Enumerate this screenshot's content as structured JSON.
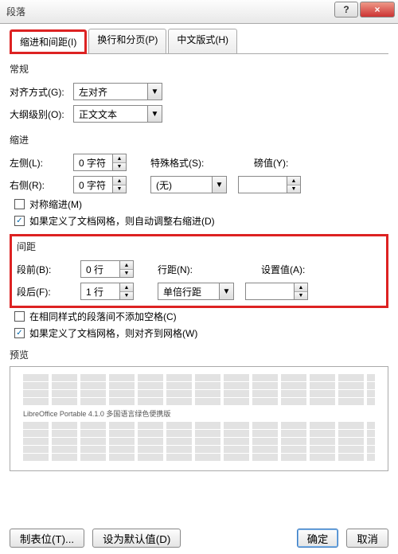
{
  "window": {
    "title": "段落",
    "help_icon": "?",
    "close_icon": "×"
  },
  "tabs": {
    "t1": "缩进和间距(I)",
    "t2": "换行和分页(P)",
    "t3": "中文版式(H)"
  },
  "general": {
    "title": "常规",
    "align_label": "对齐方式(G):",
    "align_value": "左对齐",
    "outline_label": "大纲级别(O):",
    "outline_value": "正文文本"
  },
  "indent": {
    "title": "缩进",
    "left_label": "左侧(L):",
    "left_value": "0 字符",
    "right_label": "右侧(R):",
    "right_value": "0 字符",
    "special_label": "特殊格式(S):",
    "special_value": "(无)",
    "by_label": "磅值(Y):",
    "by_value": "",
    "mirror": "对称缩进(M)",
    "autogrid": "如果定义了文档网格，则自动调整右缩进(D)"
  },
  "spacing": {
    "title": "间距",
    "before_label": "段前(B):",
    "before_value": "0 行",
    "after_label": "段后(F):",
    "after_value": "1 行",
    "line_label": "行距(N):",
    "line_value": "单倍行距",
    "at_label": "设置值(A):",
    "at_value": "",
    "nosamestype": "在相同样式的段落间不添加空格(C)",
    "snapgrid": "如果定义了文档网格，则对齐到网格(W)"
  },
  "preview": {
    "title": "预览",
    "midtext": "LibreOffice Portable 4.1.0 多国语言绿色便携版"
  },
  "footer": {
    "tabstops": "制表位(T)...",
    "default": "设为默认值(D)",
    "ok": "确定",
    "cancel": "取消"
  }
}
